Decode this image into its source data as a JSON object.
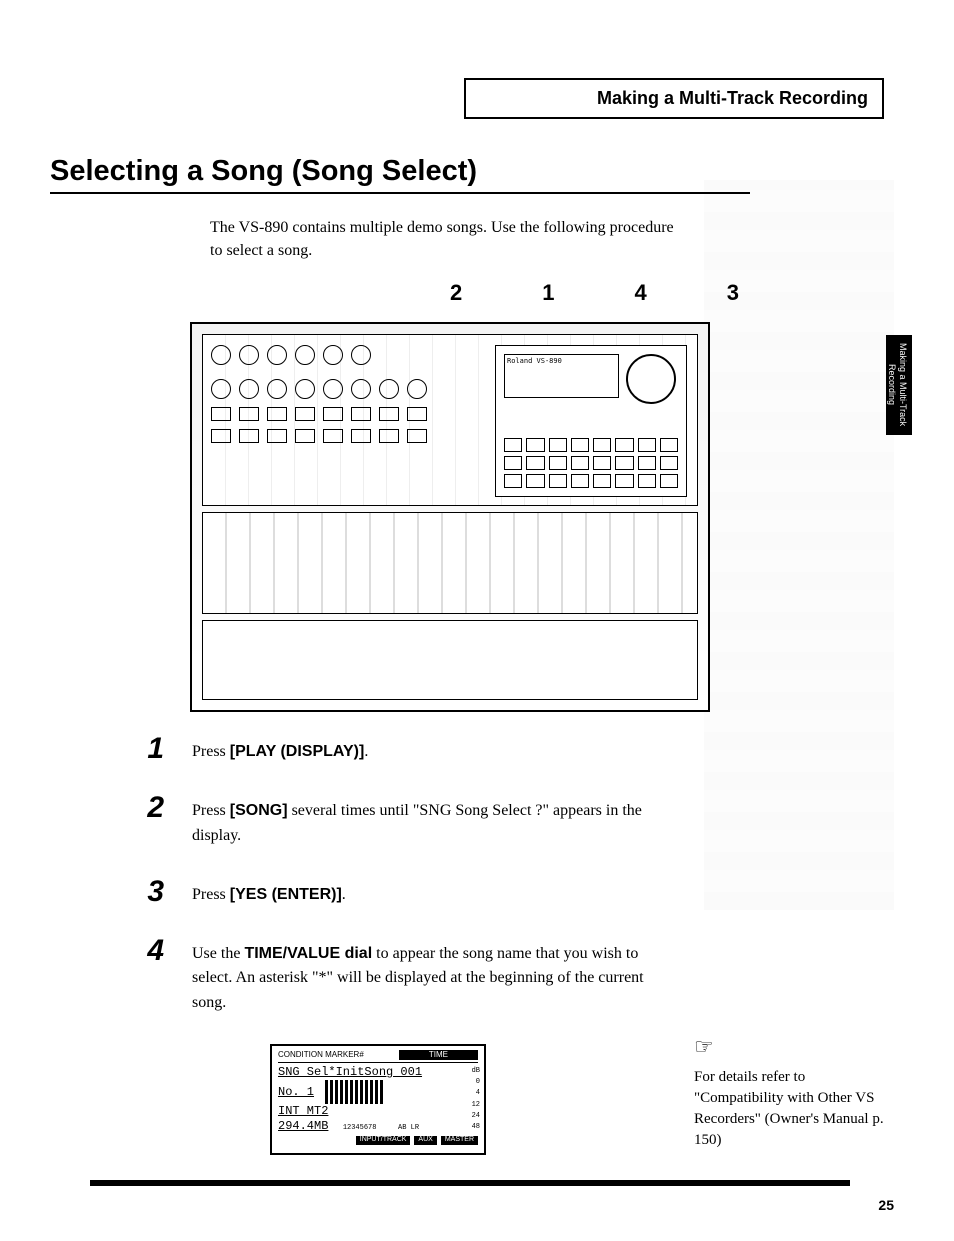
{
  "section_header": "Making a Multi-Track Recording",
  "side_tab": "Making a Multi-Track Recording",
  "heading": "Selecting a Song (Song Select)",
  "intro": "The VS-890 contains multiple demo songs. Use the following procedure to select a song.",
  "callouts": [
    "2",
    "1",
    "4",
    "3"
  ],
  "device": {
    "brand": "Roland",
    "model": "VS-890"
  },
  "steps": [
    {
      "num": "1",
      "parts": [
        {
          "t": "plain",
          "v": "Press "
        },
        {
          "t": "bold",
          "v": "[PLAY (DISPLAY)]"
        },
        {
          "t": "plain",
          "v": "."
        }
      ]
    },
    {
      "num": "2",
      "parts": [
        {
          "t": "plain",
          "v": "Press "
        },
        {
          "t": "bold",
          "v": "[SONG]"
        },
        {
          "t": "plain",
          "v": " several times until \"SNG Song Select ?\" appears in the display."
        }
      ]
    },
    {
      "num": "3",
      "parts": [
        {
          "t": "plain",
          "v": "Press "
        },
        {
          "t": "bold",
          "v": "[YES (ENTER)]"
        },
        {
          "t": "plain",
          "v": "."
        }
      ]
    },
    {
      "num": "4",
      "parts": [
        {
          "t": "plain",
          "v": "Use the "
        },
        {
          "t": "bold",
          "v": "TIME/VALUE dial"
        },
        {
          "t": "plain",
          "v": " to appear the song name that you wish to select. An asterisk \"*\" will be displayed at the beginning of the current song."
        }
      ]
    }
  ],
  "lcd": {
    "header_left": "CONDITION  MARKER#",
    "header_right": "TIME",
    "line1": "SNG Sel*InitSong 001",
    "line2_left": "No.  1",
    "line3": "INT MT2",
    "line4": "294.4MB",
    "scale": "12345678",
    "scale_right": "AB  LR",
    "footer": [
      "INPUT/TRACK",
      "AUX",
      "MASTER"
    ],
    "side": [
      "dB",
      "0",
      "4",
      "12",
      "24",
      "48"
    ]
  },
  "note": {
    "icon": "☞",
    "text": "For details refer to \"Compatibility with Other VS Recorders\" (Owner's Manual p. 150)"
  },
  "page_number": "25"
}
